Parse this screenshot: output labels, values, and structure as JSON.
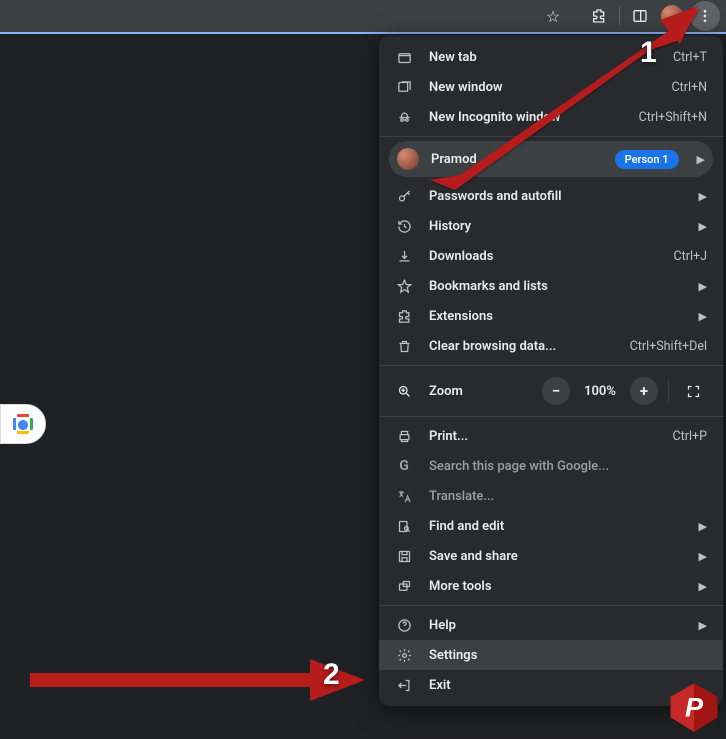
{
  "toolbar": {
    "bookmark_icon": "☆",
    "extensions_icon": "⧉",
    "panel_icon": "◧"
  },
  "menu": {
    "new_tab": "New tab",
    "new_tab_sc": "Ctrl+T",
    "new_window": "New window",
    "new_window_sc": "Ctrl+N",
    "incognito": "New Incognito window",
    "incognito_sc": "Ctrl+Shift+N",
    "profile_name": "Pramod",
    "profile_badge": "Person 1",
    "passwords": "Passwords and autofill",
    "history": "History",
    "downloads": "Downloads",
    "downloads_sc": "Ctrl+J",
    "bookmarks": "Bookmarks and lists",
    "extensions": "Extensions",
    "clear": "Clear browsing data...",
    "clear_sc": "Ctrl+Shift+Del",
    "zoom": "Zoom",
    "zoom_pct": "100%",
    "print": "Print...",
    "print_sc": "Ctrl+P",
    "search_g": "Search this page with Google...",
    "translate": "Translate...",
    "find_edit": "Find and edit",
    "save_share": "Save and share",
    "more_tools": "More tools",
    "help": "Help",
    "settings": "Settings",
    "exit": "Exit"
  },
  "anno": {
    "n1": "1",
    "n2": "2"
  }
}
